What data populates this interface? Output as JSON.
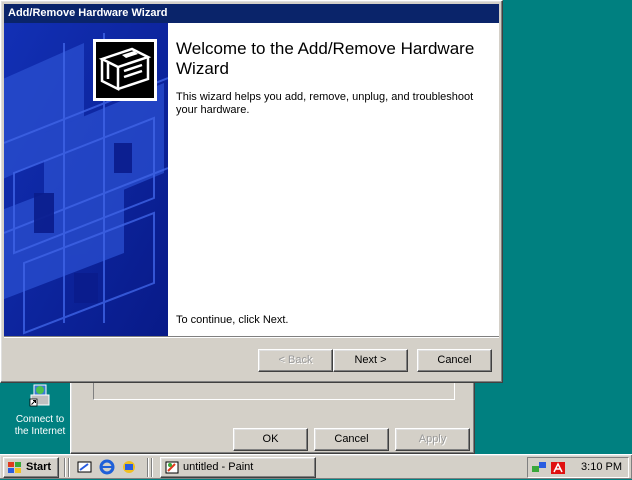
{
  "wizard": {
    "title": "Add/Remove Hardware Wizard",
    "heading": "Welcome to the Add/Remove Hardware Wizard",
    "description": "This wizard helps you add, remove, unplug, and troubleshoot your hardware.",
    "continue_text": "To continue, click Next.",
    "buttons": {
      "back": "< Back",
      "next": "Next >",
      "cancel": "Cancel"
    }
  },
  "background_dialog": {
    "buttons": {
      "ok": "OK",
      "cancel": "Cancel",
      "apply": "Apply"
    }
  },
  "desktop": {
    "icon_label_line1": "Connect to",
    "icon_label_line2": "the Internet"
  },
  "taskbar": {
    "start_label": "Start",
    "task_label": "untitled - Paint",
    "clock": "3:10 PM"
  },
  "colors": {
    "desktop": "#008080",
    "title_bar": "#0a246a",
    "side_panel": "#0b1f97",
    "face": "#d4d0c8"
  }
}
